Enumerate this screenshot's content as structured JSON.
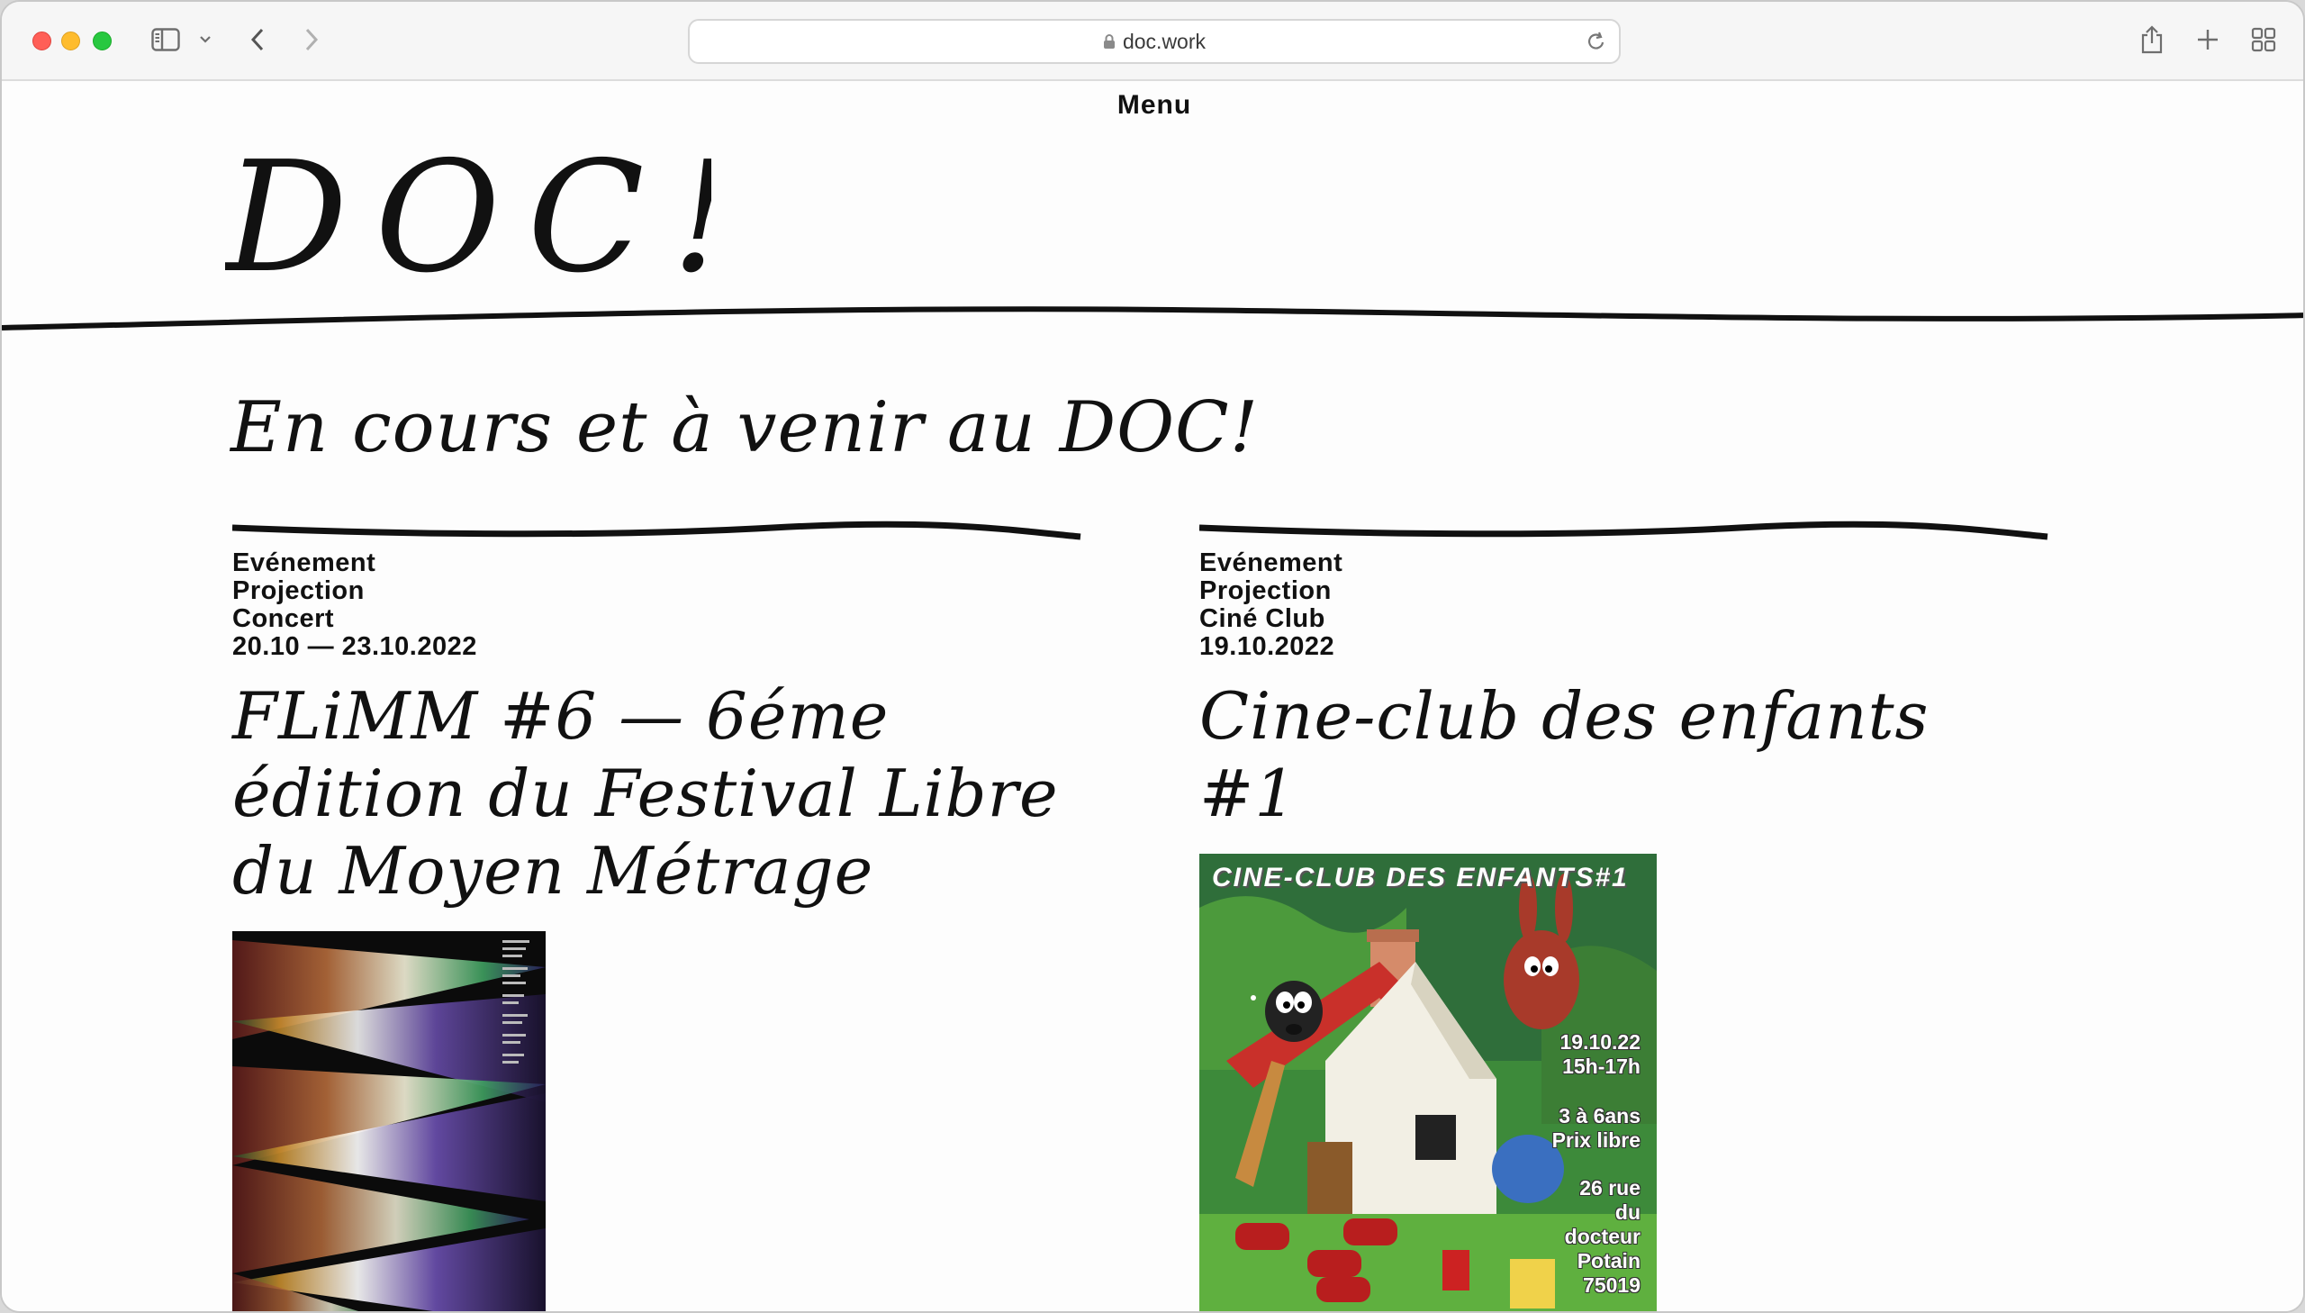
{
  "browser": {
    "url": "doc.work"
  },
  "site": {
    "menu_label": "Menu",
    "logo_text": "DOC!"
  },
  "section": {
    "title": "En cours et à venir au DOC!"
  },
  "events": [
    {
      "meta": [
        "Evénement",
        "Projection",
        "Concert",
        "20.10 — 23.10.2022"
      ],
      "title": "FLiMM #6 — 6éme édition du Festival Libre du Moyen Métrage"
    },
    {
      "meta": [
        "Evénement",
        "Projection",
        "Ciné Club",
        "19.10.2022"
      ],
      "title": "Cine-club des enfants #1",
      "poster": {
        "banner": "CINE-CLUB DES ENFANTS#1",
        "date": "19.10.22",
        "time": "15h-17h",
        "age": "3 à 6ans",
        "price": "Prix libre",
        "address": [
          "26 rue",
          "du",
          "docteur",
          "Potain",
          "75019"
        ]
      }
    }
  ]
}
